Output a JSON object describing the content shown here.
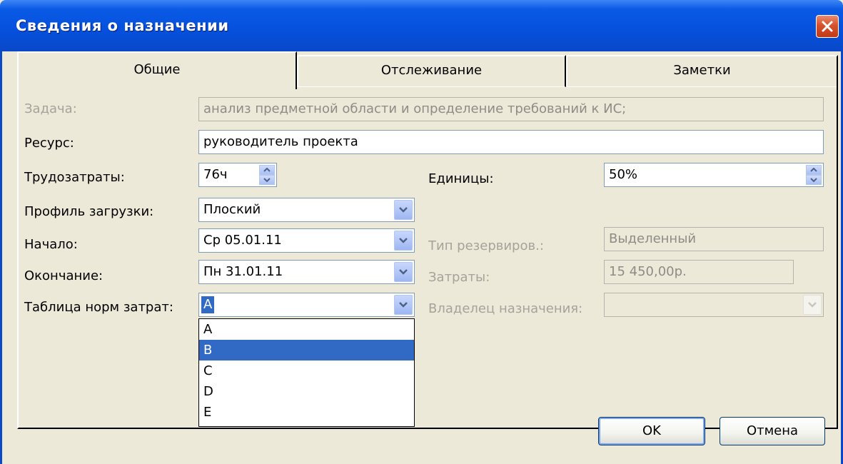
{
  "window": {
    "title": "Сведения о назначении",
    "close_icon": "close-icon"
  },
  "tabs": [
    {
      "label": "Общие"
    },
    {
      "label": "Отслеживание"
    },
    {
      "label": "Заметки"
    }
  ],
  "form": {
    "task": {
      "label": "Задача:",
      "value": "анализ предметной области и определение требований к ИС;"
    },
    "resource": {
      "label": "Ресурс:",
      "value": "руководитель проекта"
    },
    "work": {
      "label": "Трудозатраты:",
      "value": "76ч"
    },
    "units": {
      "label": "Единицы:",
      "value": "50%"
    },
    "contour": {
      "label": "Профиль загрузки:",
      "value": "Плоский"
    },
    "start": {
      "label": "Начало:",
      "value": "Ср 05.01.11"
    },
    "booking_type": {
      "label": "Тип резервиров.:",
      "value": "Выделенный"
    },
    "finish": {
      "label": "Окончание:",
      "value": "Пн 31.01.11"
    },
    "cost": {
      "label": "Затраты:",
      "value": "15 450,00р."
    },
    "cost_rate_table": {
      "label": "Таблица норм затрат:",
      "value": "A"
    },
    "owner": {
      "label": "Владелец назначения:",
      "value": ""
    }
  },
  "cost_rate_options": [
    "A",
    "B",
    "C",
    "D",
    "E"
  ],
  "buttons": {
    "ok": "OK",
    "cancel": "Отмена"
  },
  "colors": {
    "titlebar": "#0550dc",
    "dialog_bg": "#ece9d8",
    "selection": "#316ac5",
    "close": "#d6512c"
  }
}
